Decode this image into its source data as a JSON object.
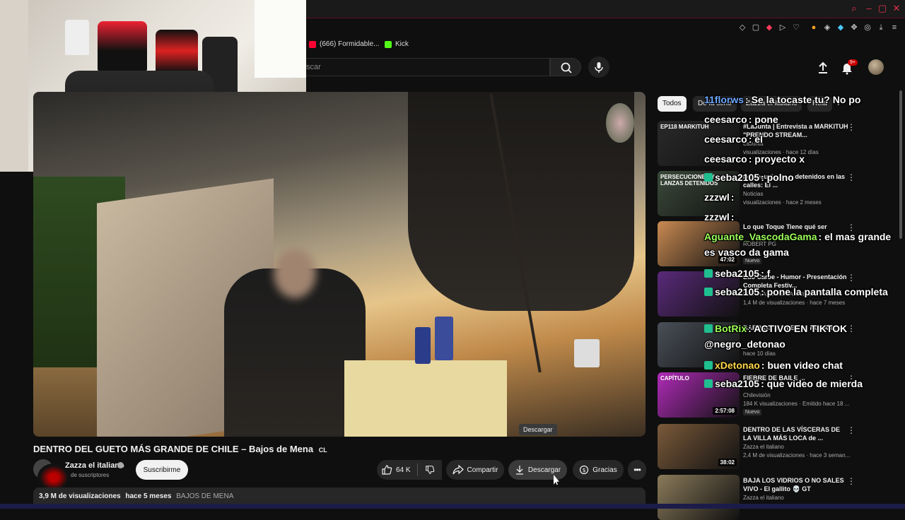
{
  "browser": {
    "bookmarks": [
      {
        "label": "(666) Formidable...",
        "color": "#ff0033"
      },
      {
        "label": "Kick",
        "color": "#53fc18"
      }
    ],
    "notification_count": "9+"
  },
  "search": {
    "placeholder": "scar"
  },
  "video": {
    "title": "DENTRO DEL GUETO MÁS GRANDE DE CHILE – Bajos de Mena",
    "title_suffix": "CL",
    "channel": "Zazza el italiano",
    "subscribers": "de suscriptores",
    "subscribe_label": "Suscribirme",
    "likes": "64 K",
    "share_label": "Compartir",
    "download_label": "Descargar",
    "thanks_label": "Gracias",
    "views": "3,9 M de visualizaciones",
    "age": "hace 5 meses",
    "hashtag": "BAJOS DE MENA",
    "tooltip": "Descargar"
  },
  "chips": [
    {
      "label": "Todos",
      "active": true
    },
    {
      "label": "De la serie",
      "active": false
    },
    {
      "label": "Zazza el italiano",
      "active": false
    },
    {
      "label": "Rela",
      "active": false
    }
  ],
  "recommendations": [
    {
      "title": "#LaJunta | Entrevista a MARKITUH \"PRENDO STREAM...",
      "channel": "LaJunta",
      "meta": "visualizaciones · hace 12 días",
      "duration": "",
      "badge": "",
      "thumb_label": "EP118 MARKITUH",
      "thumb_color": "#2a2a2a"
    },
    {
      "title": "Persecuciones y detenidos en las calles: El ...",
      "channel": "Noticias",
      "meta": "visualizaciones · hace 2 meses",
      "duration": "",
      "badge": "",
      "thumb_label": "PERSECUCIONES Y LANZAS DETENIDOS",
      "thumb_color": "#3b4a3a"
    },
    {
      "title": "Lo que Toque Tiene qué ser",
      "channel": "ROBERT PG",
      "meta": "",
      "duration": "47:02",
      "badge": "Nuevo",
      "thumb_label": "",
      "thumb_color": "#c98a52"
    },
    {
      "title": "Edo Caroe - Humor - Presentación Completa Festiv...",
      "channel": "FESTIVAL DE VIÑA CHILE",
      "meta": "1,4 M de visualizaciones · hace 7 meses",
      "duration": "",
      "badge": "",
      "thumb_label": "",
      "thumb_color": "#5a2a7a"
    },
    {
      "title": "BARRIOS SIN LEY de ROSARI...",
      "channel": "",
      "meta": "hace 10 días",
      "duration": "",
      "badge": "",
      "thumb_label": "",
      "thumb_color": "#4a5058"
    },
    {
      "title": "FIEBRE DE BAILE ...",
      "channel": "Chilevisión",
      "meta": "184 K visualizaciones · Emitido hace 18 ...",
      "duration": "2:57:08",
      "badge": "Nuevo",
      "thumb_label": "CAPÍTULO",
      "thumb_color": "#b02bb8"
    },
    {
      "title": "DENTRO DE LAS VÍSCERAS DE LA VILLA MÁS LOCA de ...",
      "channel": "Zazza el italiano",
      "meta": "2,4 M de visualizaciones · hace 3 seman...",
      "duration": "38:02",
      "badge": "",
      "thumb_label": "",
      "thumb_color": "#7a5a3a"
    },
    {
      "title": "BAJA LOS VIDRIOS O NO SALES VIVO - El gallito 💀 GT",
      "channel": "Zazza el italiano",
      "meta": "",
      "duration": "",
      "badge": "",
      "thumb_label": "",
      "thumb_color": "#8a7a5a"
    }
  ],
  "chat": [
    {
      "user": "11florws",
      "user_color": "#6fa8ff",
      "message": ": Se la tocaste tu? No po"
    },
    {
      "user": "ceesarco",
      "user_color": "#ffffff",
      "message": ": pone"
    },
    {
      "user": "ceesarco",
      "user_color": "#ffffff",
      "message": ": el"
    },
    {
      "user": "ceesarco",
      "user_color": "#ffffff",
      "message": ": proyecto x"
    },
    {
      "user": "seba2105",
      "user_color": "#ffffff",
      "message": ": polno"
    },
    {
      "user": "zzzwl",
      "user_color": "#ffffff",
      "message": ":"
    },
    {
      "user": "zzzwl",
      "user_color": "#ffffff",
      "message": ":"
    },
    {
      "user": "Aguante_VascodaGama",
      "user_color": "#9dff5a",
      "message": ": el mas grande es vasco da gama"
    },
    {
      "user": "seba2105",
      "user_color": "#ffffff",
      "message": ": f"
    },
    {
      "user": "seba2105",
      "user_color": "#ffffff",
      "message": ": pone la pantalla completa"
    },
    {
      "user": "BotRix",
      "user_color": "#9dff5a",
      "message": ": ACTIVO EN TIKTOK @negro_detonao"
    },
    {
      "user": "xDetonao",
      "user_color": "#ffd84a",
      "message": ": buen video chat"
    },
    {
      "user": "seba2105",
      "user_color": "#ffffff",
      "message": ": que video de mierda"
    }
  ],
  "colors": {
    "accent": "#ff0033",
    "kick": "#53fc18",
    "chat_badge": "#1fbf8f"
  }
}
